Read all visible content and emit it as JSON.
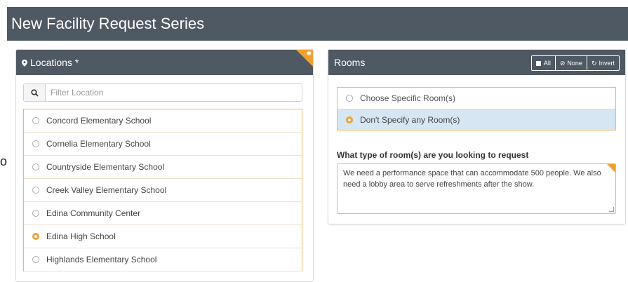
{
  "page": {
    "title": "New Facility Request Series",
    "stub_text": "o"
  },
  "locations": {
    "heading": "Locations *",
    "filter_placeholder": "Filter Location",
    "items": [
      {
        "label": "Concord Elementary School",
        "selected": false
      },
      {
        "label": "Cornelia Elementary School",
        "selected": false
      },
      {
        "label": "Countryside Elementary School",
        "selected": false
      },
      {
        "label": "Creek Valley Elementary School",
        "selected": false
      },
      {
        "label": "Edina Community Center",
        "selected": false
      },
      {
        "label": "Edina High School",
        "selected": true
      },
      {
        "label": "Highlands Elementary School",
        "selected": false
      }
    ]
  },
  "rooms": {
    "heading": "Rooms",
    "btn_all": "All",
    "btn_none": "None",
    "btn_invert": "Invert",
    "options": [
      {
        "label": "Choose Specific Room(s)",
        "selected": false
      },
      {
        "label": "Don't Specify any Room(s)",
        "selected": true
      }
    ],
    "question": "What type of room(s) are you looking to request",
    "answer": "We need a performance space that can accommodate 500 people. We also need a lobby area to serve refreshments after the show."
  },
  "colors": {
    "header_bg": "#4f5963",
    "accent": "#f0a030",
    "selected_row": "#d6e7f3"
  }
}
